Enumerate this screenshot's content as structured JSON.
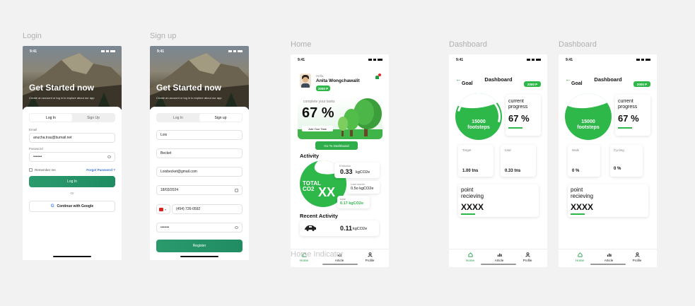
{
  "frames": {
    "login": "Login",
    "signup": "Sign up",
    "home": "Home",
    "dashboard1": "Dashboard",
    "dashboard2": "Dashboard"
  },
  "status_time": "9:41",
  "login": {
    "title": "Get Started now",
    "subtitle": "Create an account or log in to explore about our app",
    "tab_login": "Log In",
    "tab_signup": "Sign Up",
    "email_label": "Email",
    "email_value": "anucha.trau@bumail.net",
    "password_label": "Password",
    "password_value": "•••••••",
    "remember": "Remember me",
    "forgot": "Forgot Password ?",
    "login_button": "Log In",
    "or": "Or",
    "google_button": "Continue with Google"
  },
  "signup": {
    "title": "Get Started now",
    "subtitle": "Create an account or log in to explore about our app",
    "tab_login": "Log In",
    "tab_signup": "Sign up",
    "first_name": "Lois",
    "last_name": "Becket",
    "email": "Loisbecket@gmail.com",
    "dob": "18/03/2024",
    "phone": "(454) 726-0592",
    "password": "•••••••",
    "register_button": "Register"
  },
  "home": {
    "hello": "Hello,",
    "name": "Anita Wongchawalit",
    "points": "2000 P",
    "complete": "complete your tasks",
    "percent": "67 %",
    "add_task": "Add Your Task",
    "goto_dashboard": "Go To Dashboard",
    "activity_title": "Activity",
    "total_label": "TOTAL CO2",
    "total_value": "XX",
    "emission_label": "Emission",
    "emission_value": "0.33",
    "emission_unit": "kgCO2e",
    "lastmonth_label": "Last month",
    "lastmonth_value": "0.5o kgCO2e",
    "total_small_label": "total",
    "total_small_value": "0.17 kgCO2e",
    "recent_title": "Recent Activity",
    "recent_value": "0.11",
    "recent_unit": "kgCO2e",
    "overlay_text": "Home Indicator"
  },
  "dashboard1": {
    "title": "Dashboard",
    "goal": "Goal",
    "points": "2000 P",
    "gauge_value": "15000",
    "gauge_unit": "footsteps",
    "progress_label": "current progress",
    "progress_value": "67 %",
    "stat1_label": "Target",
    "stat1_value": "1.00 tns",
    "stat2_label": "total",
    "stat2_value": "0.33 tns",
    "point_label": "point recieving",
    "point_value": "XXXX"
  },
  "dashboard2": {
    "title": "Dashboard",
    "goal": "Goal",
    "points": "2000 P",
    "gauge_value": "15000",
    "gauge_unit": "footsteps",
    "progress_label": "current progress",
    "progress_value": "67 %",
    "stat1_label": "Walk",
    "stat1_value": "0 %",
    "stat2_label": "Cycling",
    "stat2_value": "0 %",
    "point_label": "point recieving",
    "point_value": "XXXX"
  },
  "tabbar": {
    "home": "Home",
    "article": "Article",
    "profile": "Profile"
  },
  "colors": {
    "accent": "#2eb84a",
    "primary_button": "#229468",
    "background": "#f2f2f2"
  }
}
